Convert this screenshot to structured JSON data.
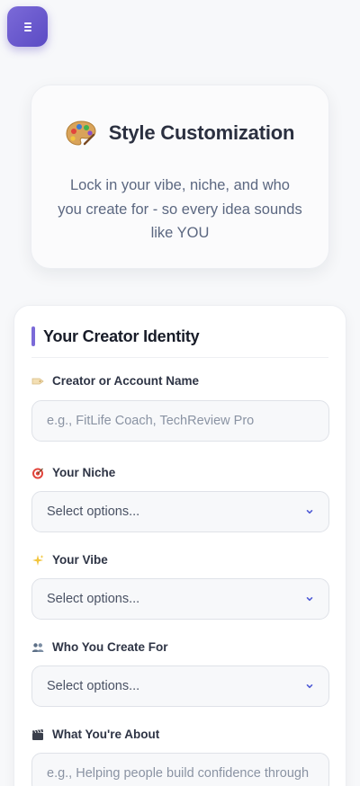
{
  "menu": {
    "icon": "menu-icon"
  },
  "hero": {
    "icon": "palette-icon",
    "title": "Style Customization",
    "subtitle": "Lock in your vibe, niche, and who you create for - so every idea sounds like YOU"
  },
  "identity": {
    "section_title": "Your Creator Identity",
    "fields": [
      {
        "icon": "label-tag-icon",
        "label": "Creator or Account Name",
        "type": "text",
        "placeholder": "e.g., FitLife Coach, TechReview Pro"
      },
      {
        "icon": "target-icon",
        "label": "Your Niche",
        "type": "select",
        "value": "Select options..."
      },
      {
        "icon": "sparkles-icon",
        "label": "Your Vibe",
        "type": "select",
        "value": "Select options..."
      },
      {
        "icon": "people-icon",
        "label": "Who You Create For",
        "type": "select",
        "value": "Select options..."
      },
      {
        "icon": "clapper-board-icon",
        "label": "What You're About",
        "type": "text",
        "placeholder": "e.g., Helping people build confidence through"
      }
    ]
  },
  "colors": {
    "accent": "#7b6ad8",
    "accent_dark": "#5b4bc4",
    "chevron": "#4f5bd5"
  }
}
